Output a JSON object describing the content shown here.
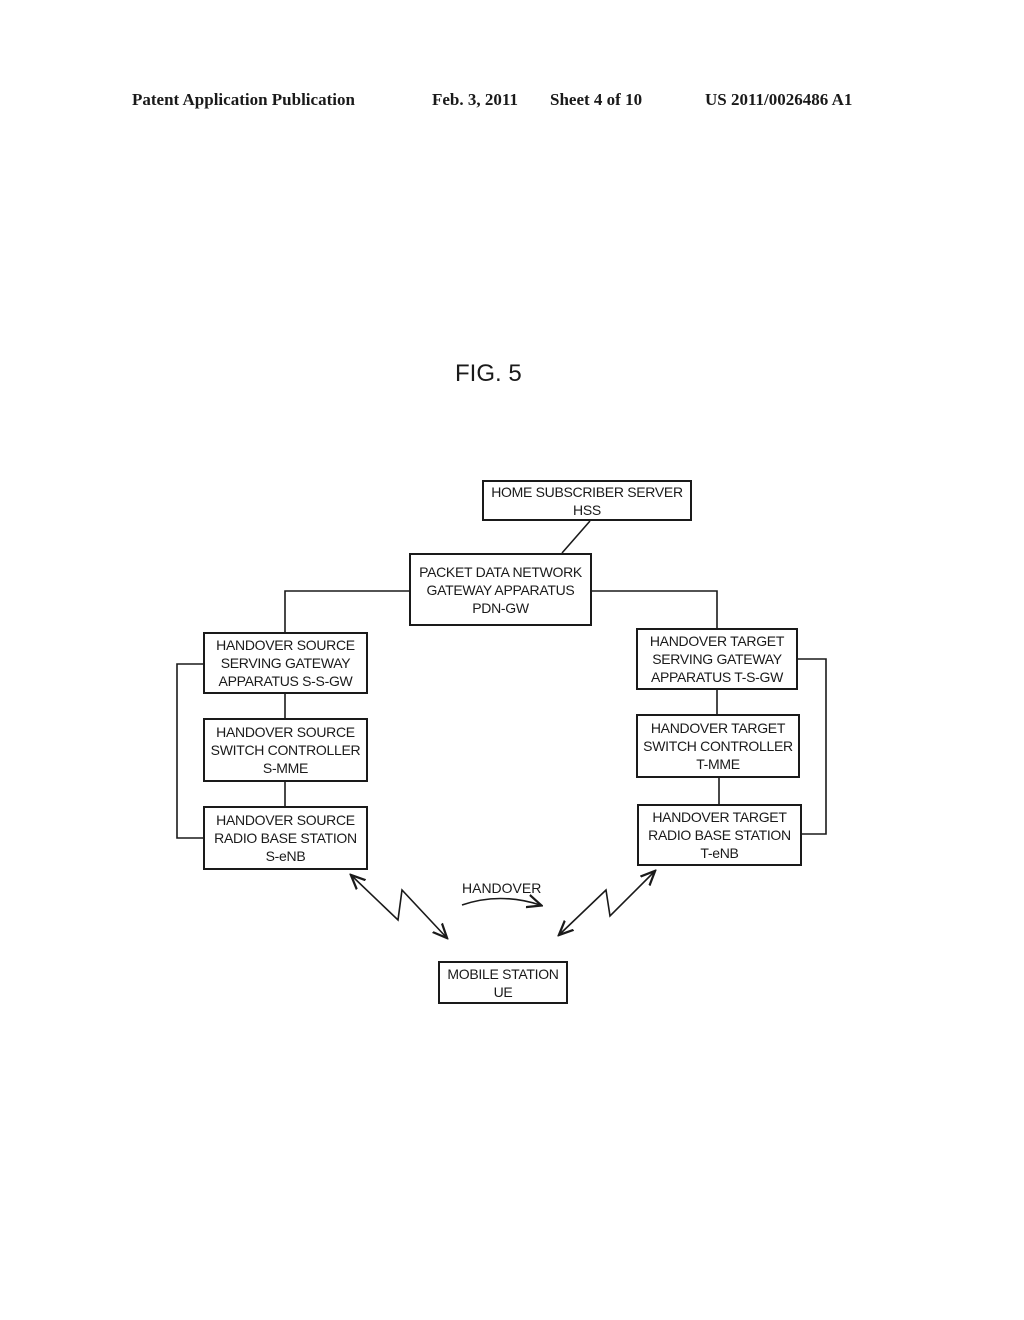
{
  "header": {
    "publication": "Patent Application Publication",
    "date": "Feb. 3, 2011",
    "sheet": "Sheet 4 of 10",
    "number": "US 2011/0026486 A1"
  },
  "figure": {
    "title": "FIG. 5",
    "handover_label": "HANDOVER",
    "nodes": {
      "hss": [
        "HOME SUBSCRIBER SERVER",
        "HSS"
      ],
      "pdn_gw": [
        "PACKET DATA NETWORK",
        "GATEWAY APPARATUS",
        "PDN-GW"
      ],
      "s_s_gw": [
        "HANDOVER SOURCE",
        "SERVING GATEWAY",
        "APPARATUS S-S-GW"
      ],
      "s_mme": [
        "HANDOVER SOURCE",
        "SWITCH CONTROLLER",
        "S-MME"
      ],
      "s_enb": [
        "HANDOVER SOURCE",
        "RADIO BASE STATION",
        "S-eNB"
      ],
      "t_s_gw": [
        "HANDOVER TARGET",
        "SERVING GATEWAY",
        "APPARATUS T-S-GW"
      ],
      "t_mme": [
        "HANDOVER TARGET",
        "SWITCH CONTROLLER",
        "T-MME"
      ],
      "t_enb": [
        "HANDOVER TARGET",
        "RADIO BASE STATION",
        "T-eNB"
      ],
      "ue": [
        "MOBILE STATION",
        "UE"
      ]
    }
  }
}
